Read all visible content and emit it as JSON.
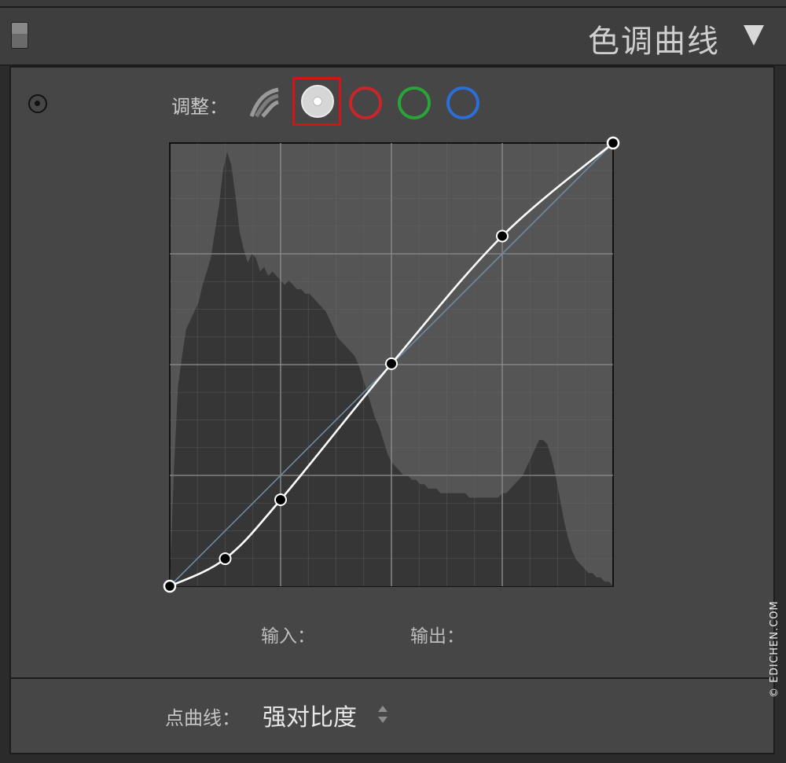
{
  "header": {
    "title": "色调曲线",
    "collapse_icon": "triangle-down-icon"
  },
  "adjust": {
    "label": "调整：",
    "channels": [
      {
        "name": "parametric",
        "icon": "parametric-curve-icon"
      },
      {
        "name": "rgb",
        "icon": "rgb-channel-icon",
        "selected": true,
        "color": "#d6d6d6"
      },
      {
        "name": "red",
        "icon": "red-channel-icon",
        "color": "#c8262b"
      },
      {
        "name": "green",
        "icon": "green-channel-icon",
        "color": "#2aa337"
      },
      {
        "name": "blue",
        "icon": "blue-channel-icon",
        "color": "#2b6ed6"
      }
    ]
  },
  "curve": {
    "points": [
      [
        0,
        0
      ],
      [
        0.125,
        0.062
      ],
      [
        0.25,
        0.195
      ],
      [
        0.5,
        0.502
      ],
      [
        0.75,
        0.79
      ],
      [
        1,
        1
      ]
    ],
    "histogram": [
      0.0,
      0.26,
      0.45,
      0.52,
      0.58,
      0.6,
      0.62,
      0.64,
      0.68,
      0.71,
      0.74,
      0.8,
      0.86,
      0.94,
      0.98,
      0.95,
      0.88,
      0.8,
      0.76,
      0.73,
      0.75,
      0.74,
      0.71,
      0.72,
      0.7,
      0.71,
      0.7,
      0.69,
      0.68,
      0.69,
      0.68,
      0.67,
      0.67,
      0.66,
      0.66,
      0.65,
      0.64,
      0.63,
      0.62,
      0.6,
      0.58,
      0.56,
      0.55,
      0.54,
      0.53,
      0.52,
      0.5,
      0.47,
      0.44,
      0.41,
      0.38,
      0.36,
      0.33,
      0.3,
      0.28,
      0.27,
      0.26,
      0.25,
      0.25,
      0.24,
      0.24,
      0.23,
      0.23,
      0.22,
      0.22,
      0.22,
      0.21,
      0.21,
      0.21,
      0.21,
      0.21,
      0.21,
      0.21,
      0.2,
      0.2,
      0.2,
      0.2,
      0.2,
      0.2,
      0.2,
      0.2,
      0.21,
      0.21,
      0.22,
      0.23,
      0.24,
      0.25,
      0.27,
      0.29,
      0.31,
      0.33,
      0.33,
      0.32,
      0.29,
      0.25,
      0.2,
      0.15,
      0.11,
      0.08,
      0.06,
      0.05,
      0.04,
      0.03,
      0.03,
      0.02,
      0.02,
      0.01,
      0.01,
      0.0
    ]
  },
  "io": {
    "input_label": "输入：",
    "output_label": "输出："
  },
  "footer": {
    "preset_label": "点曲线：",
    "preset_value": "强对比度",
    "stepper_icon": "up-down-stepper-icon"
  },
  "watermark": "© EDICHEN.COM"
}
